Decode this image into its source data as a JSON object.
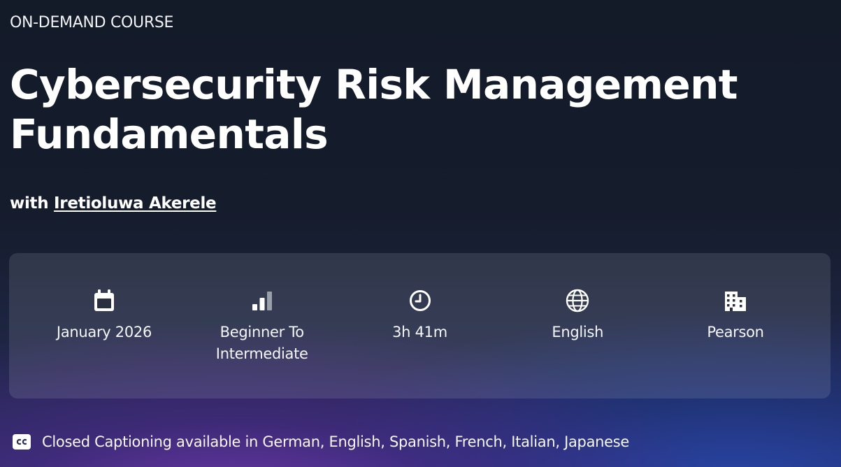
{
  "hero": {
    "eyebrow": "ON-DEMAND COURSE",
    "title": "Cybersecurity Risk Management Fundamentals",
    "byline_prefix": "with",
    "instructor": "Iretioluwa Akerele"
  },
  "meta": {
    "date": {
      "icon": "calendar-icon",
      "label": "January 2026"
    },
    "level": {
      "icon": "signal-bars-icon",
      "label": "Beginner To Intermediate"
    },
    "duration": {
      "icon": "clock-icon",
      "label": "3h 41m"
    },
    "language": {
      "icon": "globe-icon",
      "label": "English"
    },
    "publisher": {
      "icon": "building-icon",
      "label": "Pearson"
    }
  },
  "captions": {
    "icon": "closed-captions-icon",
    "text": "Closed Captioning available in German, English, Spanish, French, Italian, Japanese"
  },
  "colors": {
    "background_top": "#131a28",
    "background_bottom_left": "#6e37aa",
    "background_bottom_right": "#2846aa",
    "text": "#ffffff",
    "inactive_bar": "#9aa0aa"
  }
}
